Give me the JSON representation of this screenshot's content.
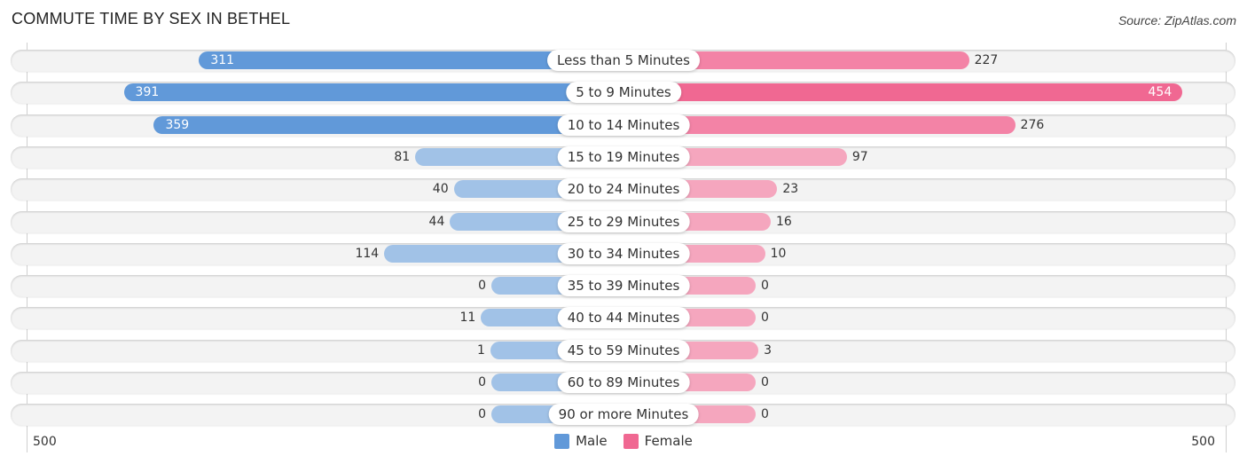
{
  "header": {
    "title": "COMMUTE TIME BY SEX IN BETHEL",
    "source": "Source: ZipAtlas.com"
  },
  "colors": {
    "male_strong": "#6199d9",
    "male_light": "#a1c2e7",
    "female_strong": "#f06892",
    "female_light": "#f5a6be",
    "row_bg": "#f3f3f3"
  },
  "chart_data": {
    "type": "bar",
    "orientation": "horizontal-diverging",
    "title": "COMMUTE TIME BY SEX IN BETHEL",
    "categories": [
      "Less than 5 Minutes",
      "5 to 9 Minutes",
      "10 to 14 Minutes",
      "15 to 19 Minutes",
      "20 to 24 Minutes",
      "25 to 29 Minutes",
      "30 to 34 Minutes",
      "35 to 39 Minutes",
      "40 to 44 Minutes",
      "45 to 59 Minutes",
      "60 to 89 Minutes",
      "90 or more Minutes"
    ],
    "series": [
      {
        "name": "Male",
        "side": "left",
        "values": [
          311,
          391,
          359,
          81,
          40,
          44,
          114,
          0,
          11,
          1,
          0,
          0
        ]
      },
      {
        "name": "Female",
        "side": "right",
        "values": [
          227,
          454,
          276,
          97,
          23,
          16,
          10,
          0,
          0,
          3,
          0,
          0
        ]
      }
    ],
    "axis": {
      "left_label": "500",
      "right_label": "500",
      "range": [
        -500,
        500
      ]
    },
    "legend": {
      "position": "bottom-center",
      "entries": [
        "Male",
        "Female"
      ]
    },
    "xlabel": "",
    "ylabel": ""
  }
}
